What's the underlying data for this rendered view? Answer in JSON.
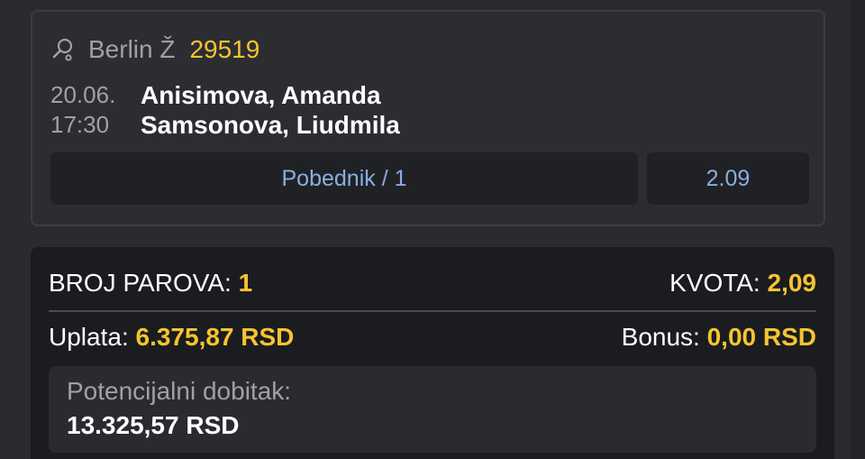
{
  "match": {
    "league": "Berlin Ž",
    "event_code": "29519",
    "date": "20.06.",
    "time": "17:30",
    "player1": "Anisimova, Amanda",
    "player2": "Samsonova, Liudmila",
    "market": "Pobednik / 1",
    "odd": "2.09",
    "sport_icon": "tennis-icon"
  },
  "summary": {
    "pairs_label": "BROJ PAROVA:",
    "pairs_value": "1",
    "odds_label": "KVOTA:",
    "odds_value": "2,09",
    "stake_label": "Uplata:",
    "stake_value": "6.375,87 RSD",
    "bonus_label": "Bonus:",
    "bonus_value": "0,00 RSD",
    "potential_label": "Potencijalni dobitak:",
    "potential_value": "13.325,57 RSD"
  },
  "colors": {
    "background": "#2a2b2f",
    "accent_yellow": "#f5c431",
    "link_blue": "#8aaee0",
    "muted_text": "#a0a1a6"
  }
}
